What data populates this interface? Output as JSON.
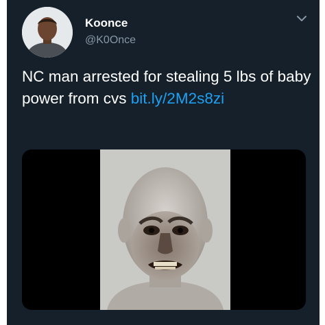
{
  "user": {
    "display_name": "Koonce",
    "handle": "@K0Once"
  },
  "tweet": {
    "text": "NC man arrested for stealing 5 lbs of baby power from cvs ",
    "link_text": "bit.ly/2M2s8zi"
  },
  "icons": {
    "menu": "chevron-down-icon"
  },
  "colors": {
    "background": "#15202b",
    "text": "#ffffff",
    "secondary": "#8899a6",
    "link": "#1da1f2"
  }
}
